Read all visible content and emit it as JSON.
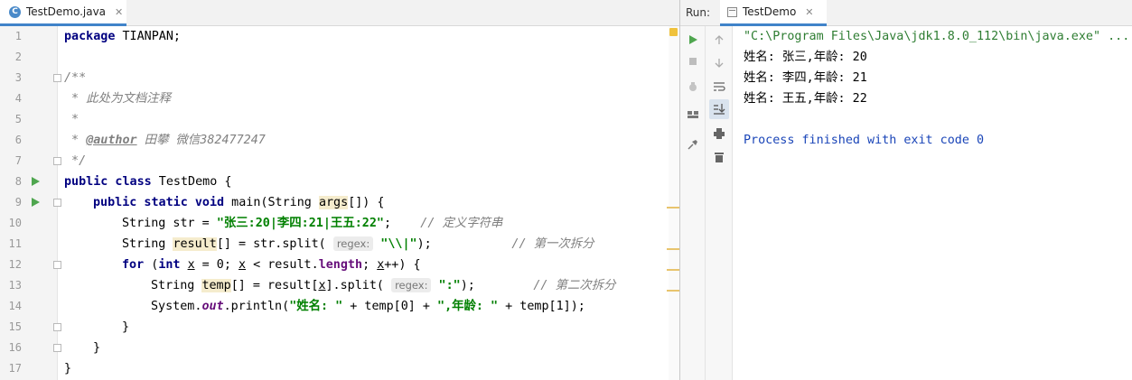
{
  "editor": {
    "tab_label": "TestDemo.java",
    "tab_icon": "C",
    "line_numbers": [
      "1",
      "2",
      "3",
      "4",
      "5",
      "6",
      "7",
      "8",
      "9",
      "10",
      "11",
      "12",
      "13",
      "14",
      "15",
      "16",
      "17"
    ],
    "code": {
      "l1_kw": "package",
      "l1_rest": " TIANPAN;",
      "l3": "/**",
      "l4": " * 此处为文档注释",
      "l5": " *",
      "l6_a": " * ",
      "l6_tag": "@author",
      "l6_b": " 田攀 微信382477247",
      "l7": " */",
      "l8_kw": "public class",
      "l8_rest": " TestDemo {",
      "l9_kw": "public static void",
      "l9_a": " main(String ",
      "l9_var": "args",
      "l9_b": "[]) {",
      "l10_a": "String str = ",
      "l10_str": "\"张三:20|李四:21|王五:22\"",
      "l10_b": ";    ",
      "l10_cmt": "// 定义字符串",
      "l11_a": "String ",
      "l11_var": "result",
      "l11_b": "[] = str.split( ",
      "l11_hint": "regex:",
      "l11_c": " ",
      "l11_str": "\"\\\\|\"",
      "l11_d": ");           ",
      "l11_cmt": "// 第一次拆分",
      "l12_kw": "for",
      "l12_a": " (",
      "l12_kw2": "int",
      "l12_b": " ",
      "l12_x1": "x",
      "l12_c": " = 0; ",
      "l12_x2": "x",
      "l12_d": " < result.",
      "l12_fld": "length",
      "l12_e": "; ",
      "l12_x3": "x",
      "l12_f": "++) {",
      "l13_a": "String ",
      "l13_var": "temp",
      "l13_b": "[] = result[",
      "l13_x": "x",
      "l13_c": "].split( ",
      "l13_hint": "regex:",
      "l13_d": " ",
      "l13_str": "\":\"",
      "l13_e": ");        ",
      "l13_cmt": "// 第二次拆分",
      "l14_a": "System.",
      "l14_out": "out",
      "l14_b": ".println(",
      "l14_str1": "\"姓名: \"",
      "l14_c": " + temp[0] + ",
      "l14_str2": "\",年龄: \"",
      "l14_d": " + temp[1]);",
      "l15": "}",
      "l16": "}",
      "l17": "}"
    }
  },
  "run": {
    "label": "Run:",
    "tab_label": "TestDemo",
    "console": {
      "cmd": "\"C:\\Program Files\\Java\\jdk1.8.0_112\\bin\\java.exe\" ...",
      "out1": "姓名: 张三,年龄: 20",
      "out2": "姓名: 李四,年龄: 21",
      "out3": "姓名: 王五,年龄: 22",
      "exit": "Process finished with exit code 0"
    }
  },
  "colors": {
    "keyword": "#000080",
    "string": "#008000",
    "comment": "#808080",
    "field": "#660e7a",
    "console_cmd": "#2e7d32",
    "console_text": "#000000",
    "console_exit": "#1a45b8",
    "run_green": "#4fa64f",
    "warning_marker": "#e8c46d"
  }
}
